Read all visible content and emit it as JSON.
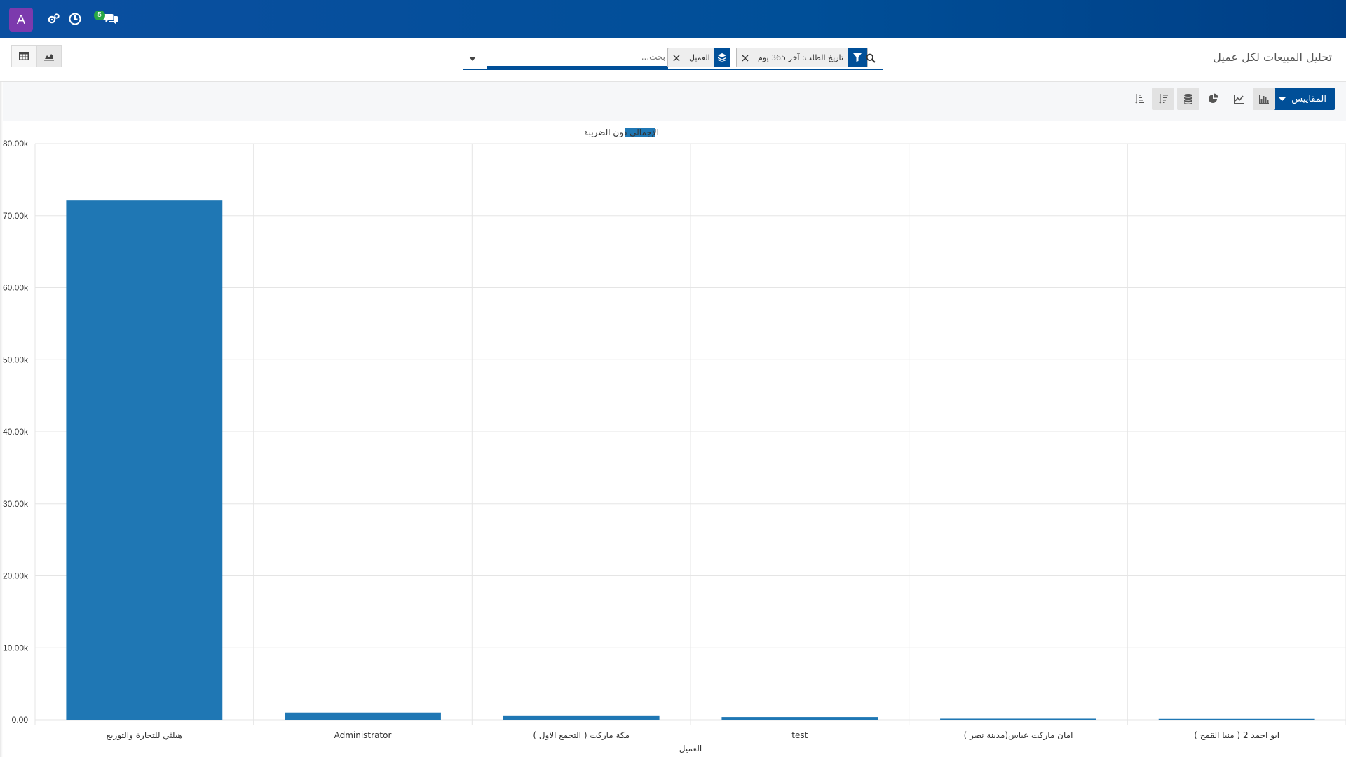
{
  "navbar": {
    "avatar_letter": "A",
    "icons": [
      "settings-icon",
      "clock-icon",
      "chat-icon"
    ],
    "chat_badge": "5"
  },
  "control_panel": {
    "title": "تحليل المبيعات لكل عميل",
    "search": {
      "placeholder": "بحث...",
      "facets": [
        {
          "label": "تاريخ الطلب: آخر 365 يوم",
          "icon": "filter-icon"
        },
        {
          "label": "العميل",
          "icon": "layers-icon"
        }
      ]
    },
    "views": [
      "table-view-icon",
      "graph-view-icon"
    ]
  },
  "toolbar": {
    "measures_label": "المقاييس",
    "tools": [
      "bar-chart-icon",
      "line-chart-icon",
      "pie-chart-icon",
      "stacked-icon",
      "sort-desc-icon",
      "sort-asc-icon"
    ]
  },
  "chart_data": {
    "type": "bar",
    "legend": "الإجمالي دون الضريبة",
    "xlabel": "العميل",
    "ylabel": "",
    "ylim": [
      0,
      80000
    ],
    "yticks": [
      "0.00",
      "10.00k",
      "20.00k",
      "30.00k",
      "40.00k",
      "50.00k",
      "60.00k",
      "70.00k",
      "80.00k"
    ],
    "categories": [
      "هيلثي للتجارة والتوزيع",
      "Administrator",
      "مكة ماركت ( التجمع الاول )",
      "test",
      "( امان ماركت عباس(مدينة نصر",
      "ابو احمد 2 ( منيا القمح )"
    ],
    "values": [
      72100,
      1000,
      600,
      380,
      150,
      120
    ],
    "colors": {
      "bar": "#1f77b4",
      "grid": "#e5e5e5"
    }
  }
}
